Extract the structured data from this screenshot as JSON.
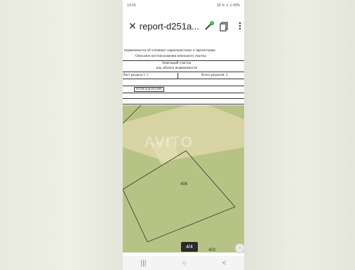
{
  "status_bar": {
    "time": "14:55",
    "right": "28 ✉ .ıl .ıl 40%"
  },
  "app_bar": {
    "close_icon": "close-icon",
    "title": "report-d251a...",
    "edit_icon": "edit-pen-icon",
    "copy_icon": "copy-icon",
    "menu_icon": "more-vert-icon"
  },
  "document": {
    "line1": "недвижимости об основных характеристиках и зарегистриро",
    "line2": "Описание местоположения земельного участка",
    "line3": "Земельный участок",
    "line4": "вид объекта недвижимости",
    "sections_left": "Лист раздела 3: 1",
    "sections_right": "Всего разделов: 3",
    "cadastral": "03:06:450103:406"
  },
  "map": {
    "parcel_label": "406",
    "corner_label": "403"
  },
  "watermark": "AVITO",
  "page_indicator": "4/4",
  "navbar": {
    "recents": "|||",
    "home": "○",
    "back": "<"
  }
}
